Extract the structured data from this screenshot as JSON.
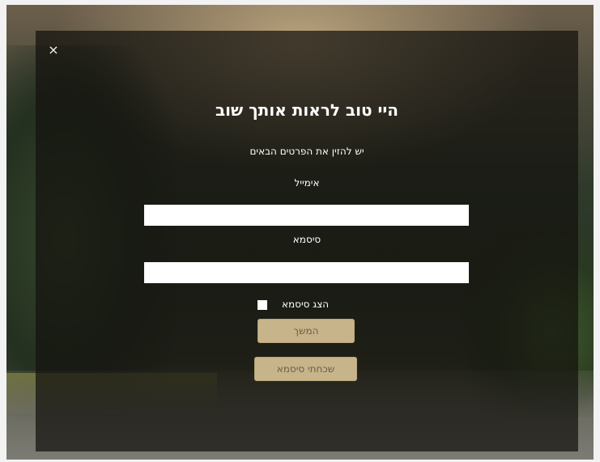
{
  "dialog": {
    "close_symbol": "×",
    "title": "היי טוב לראות אותך שוב",
    "subtitle": "יש להזין את הפרטים הבאים",
    "email_label": "אימייל",
    "email_value": "",
    "password_label": "סיסמא",
    "password_value": "",
    "show_password_label": "הצג סיסמא",
    "show_password_checked": false,
    "continue_label": "המשך",
    "forgot_password_label": "שכחתי סיסמא"
  },
  "colors": {
    "overlay": "#14120e",
    "button_bg": "#c7b48a",
    "button_text": "#6a5e48"
  }
}
